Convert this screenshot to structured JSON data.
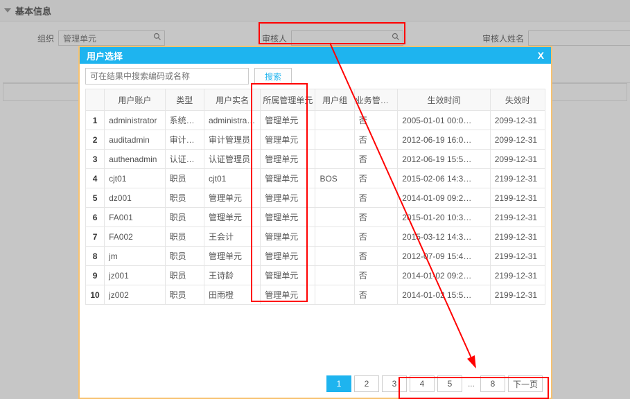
{
  "section": {
    "title": "基本信息"
  },
  "form": {
    "org_label": "组织",
    "org_value": "管理单元",
    "reviewer_label": "审核人",
    "reviewer_value": "",
    "reviewer_name_label": "审核人姓名",
    "reviewer_name_value": ""
  },
  "dialog": {
    "title": "用户选择",
    "close": "X",
    "search_placeholder": "可在结果中搜索编码或名称",
    "search_btn": "搜索",
    "columns": {
      "acct": "用户账户",
      "type": "类型",
      "real": "用户实名",
      "org": "所属管理单元",
      "grp": "用户组",
      "biz": "业务管理员",
      "eff": "生效时间",
      "exp": "失效时"
    },
    "rows": [
      {
        "i": "1",
        "acct": "administrator",
        "type": "系统用户",
        "real": "administrator",
        "org": "管理单元",
        "grp": "",
        "biz": "否",
        "eff": "2005-01-01 00:0…",
        "exp": "2099-12-31"
      },
      {
        "i": "2",
        "acct": "auditadmin",
        "type": "审计管…",
        "real": "审计管理员",
        "org": "管理单元",
        "grp": "",
        "biz": "否",
        "eff": "2012-06-19 16:0…",
        "exp": "2099-12-31"
      },
      {
        "i": "3",
        "acct": "authenadmin",
        "type": "认证管…",
        "real": "认证管理员",
        "org": "管理单元",
        "grp": "",
        "biz": "否",
        "eff": "2012-06-19 15:5…",
        "exp": "2099-12-31"
      },
      {
        "i": "4",
        "acct": "cjt01",
        "type": "职员",
        "real": "cjt01",
        "org": "管理单元",
        "grp": "BOS",
        "biz": "否",
        "eff": "2015-02-06 14:3…",
        "exp": "2199-12-31"
      },
      {
        "i": "5",
        "acct": "dz001",
        "type": "职员",
        "real": "管理单元",
        "org": "管理单元",
        "grp": "",
        "biz": "否",
        "eff": "2014-01-09 09:2…",
        "exp": "2199-12-31"
      },
      {
        "i": "6",
        "acct": "FA001",
        "type": "职员",
        "real": "管理单元",
        "org": "管理单元",
        "grp": "",
        "biz": "否",
        "eff": "2015-01-20 10:3…",
        "exp": "2199-12-31"
      },
      {
        "i": "7",
        "acct": "FA002",
        "type": "职员",
        "real": "王会计",
        "org": "管理单元",
        "grp": "",
        "biz": "否",
        "eff": "2015-03-12 14:3…",
        "exp": "2199-12-31"
      },
      {
        "i": "8",
        "acct": "jm",
        "type": "职员",
        "real": "管理单元",
        "org": "管理单元",
        "grp": "",
        "biz": "否",
        "eff": "2012-07-09 15:4…",
        "exp": "2199-12-31"
      },
      {
        "i": "9",
        "acct": "jz001",
        "type": "职员",
        "real": "王诗龄",
        "org": "管理单元",
        "grp": "",
        "biz": "否",
        "eff": "2014-01-02 09:2…",
        "exp": "2199-12-31"
      },
      {
        "i": "10",
        "acct": "jz002",
        "type": "职员",
        "real": "田雨橙",
        "org": "管理单元",
        "grp": "",
        "biz": "否",
        "eff": "2014-01-02 15:5…",
        "exp": "2199-12-31"
      }
    ],
    "pager": {
      "pages": [
        "1",
        "2",
        "3",
        "4",
        "5"
      ],
      "last": "8",
      "next": "下一页",
      "active": "1"
    }
  }
}
